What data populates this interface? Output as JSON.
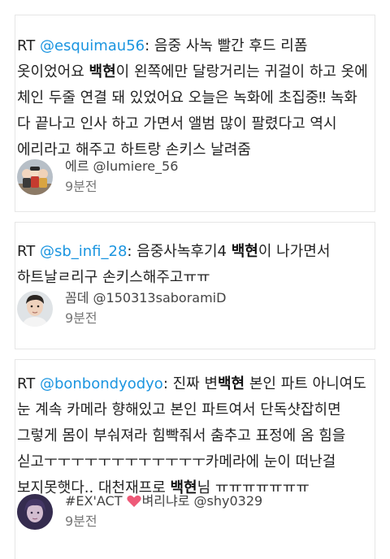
{
  "tweets": [
    {
      "rt": "RT",
      "mention": "@esquimau56",
      "text_a": ": 음중 사녹 빨간 후드 리폼 옷이었어요 ",
      "bold": "백현",
      "text_b": "이 왼쪽에만 달랑거리는 귀걸이 하고 옷에 체인 두줄 연결 돼 있었어요 오늘은 녹화에 초집중‼ 녹화 다 끝나고 인사 하고 가면서 앨범 많이 팔렸다고 역시 에리라고 해주고 하트랑 손키스 날려줌",
      "author": "에르 @lumiere_56",
      "time": "9분전",
      "avatar_icon": "avatar-figurines"
    },
    {
      "rt": "RT",
      "mention": "@sb_infi_28",
      "text_a": ": 음중사녹후기4 ",
      "bold": "백현",
      "text_b": "이 나가면서 하트날ㄹ리구 손키스해주고ㅠㅠ",
      "author": "꼼데 @150313saboramiD",
      "time": "9분전",
      "avatar_icon": "avatar-person"
    },
    {
      "rt": "RT",
      "mention": "@bonbondyodyo",
      "text_a": ": 진짜 변",
      "bold": "백현",
      "text_b": " 본인 파트 아니여도 눈 계속 카메라 향해있고 본인 파트여서 단독샷잡히면 그렇게 몸이 부숴져라 힘빡줘서 춤추고 표정에 옴 힘을 싣고ㅜㅜㅜㅜㅜㅜㅜㅜㅜㅜㅜㅜ카메라에 눈이 떠난걸 보지못햇다.. 대천재프로 ",
      "bold2": "백현",
      "text_c": "님 ㅠㅠㅠㅠㅠㅠㅠ",
      "author_a": "#EX'ACT ",
      "author_b": "벼리냐로 @shy0329",
      "time": "9분전",
      "avatar_icon": "avatar-person-dark",
      "heart_color": "#ee5a78"
    }
  ]
}
